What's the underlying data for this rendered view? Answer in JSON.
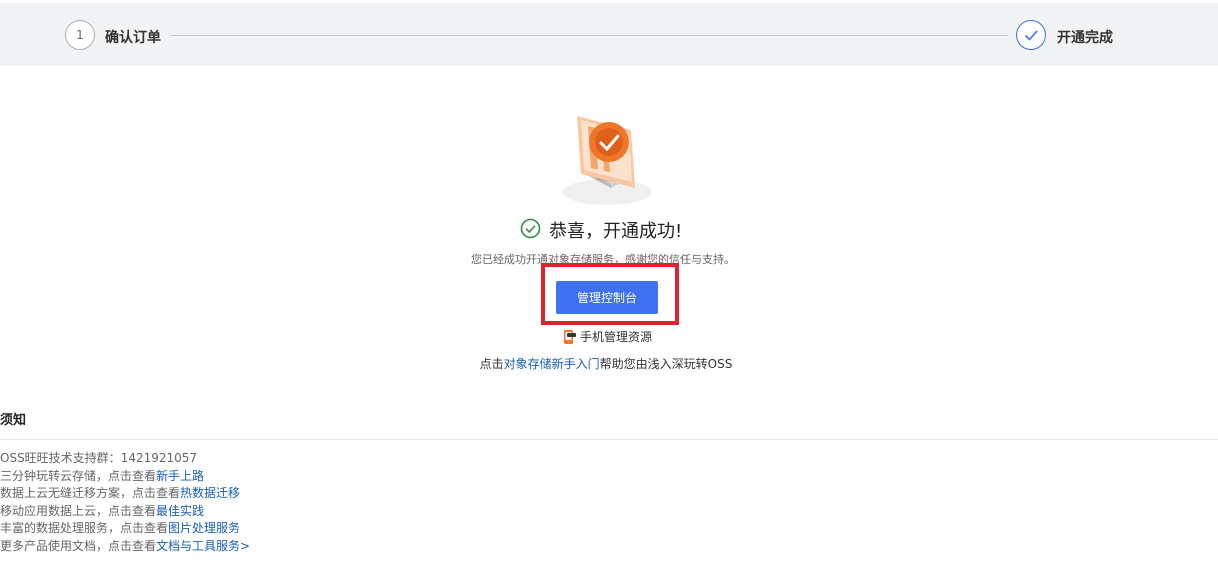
{
  "steps": [
    {
      "number": "1",
      "label": "确认订单"
    },
    {
      "label": "开通完成"
    }
  ],
  "success": {
    "title": "恭喜，开通成功!",
    "subtitle": "您已经成功开通对象存储服务，感谢您的信任与支持。"
  },
  "console_button": "管理控制台",
  "mobile_manage": "手机管理资源",
  "help": {
    "prefix": "点击",
    "link": "对象存储新手入门",
    "suffix": "帮助您由浅入深玩转OSS"
  },
  "notes": {
    "title": "须知",
    "items": [
      {
        "text": "OSS旺旺技术支持群：1421921057",
        "link": ""
      },
      {
        "text": "三分钟玩转云存储，点击查看",
        "link": "新手上路"
      },
      {
        "text": "数据上云无缝迁移方案，点击查看",
        "link": "热数据迁移"
      },
      {
        "text": "移动应用数据上云，点击查看",
        "link": "最佳实践"
      },
      {
        "text": "丰富的数据处理服务，点击查看",
        "link": "图片处理服务"
      },
      {
        "text": "更多产品使用文档，点击查看",
        "link": "文档与工具服务>"
      }
    ]
  },
  "colors": {
    "primary": "#4070f4",
    "highlight_box": "#e0222e",
    "success_green": "#3a8a4a",
    "link": "#1a5fb4",
    "illustration_orange": "#f0762a"
  },
  "icons": {
    "step_done": "check-icon",
    "success": "check-circle-icon",
    "mobile": "phone-icon",
    "illustration": "monitor-check-illustration"
  }
}
